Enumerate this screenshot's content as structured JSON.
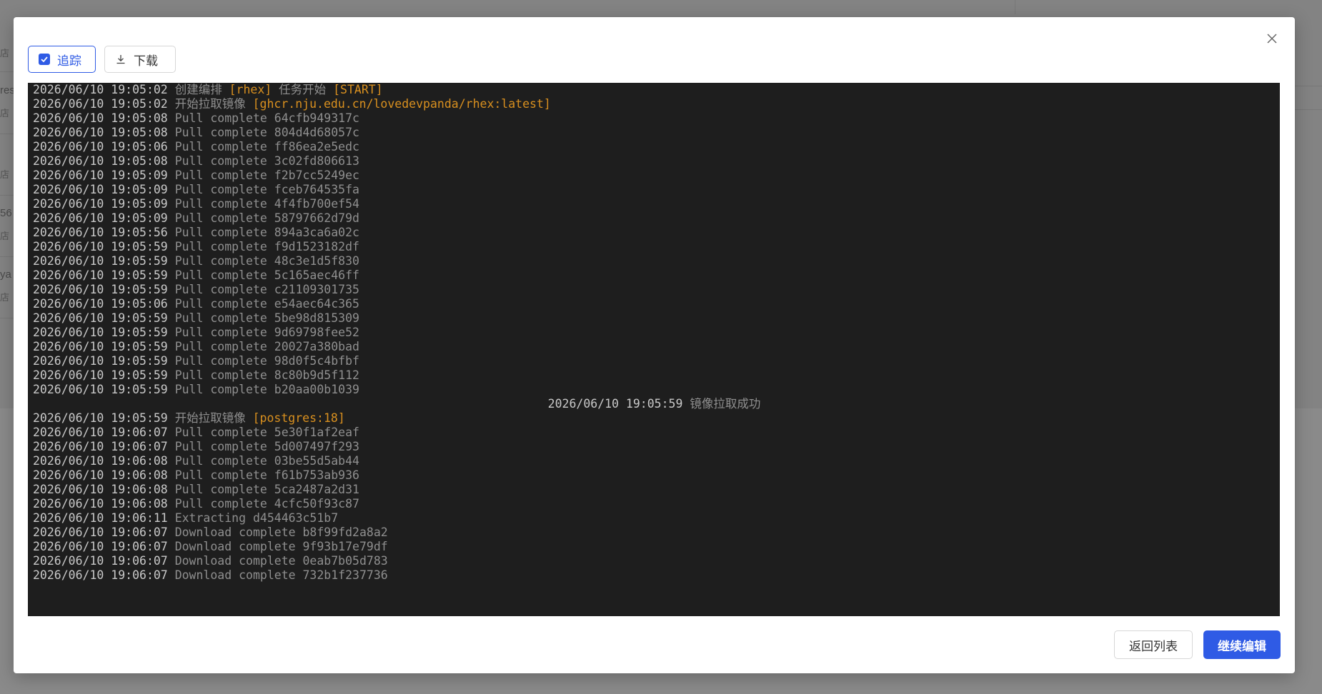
{
  "background": {
    "fragments": [
      "店",
      "res",
      "店",
      "店",
      "56",
      "店",
      "ya",
      "店"
    ]
  },
  "modal": {
    "toolbar": {
      "track_label": "追踪",
      "track_checked": true,
      "download_label": "下载"
    },
    "log": [
      {
        "ts": "2026/06/10 19:05:02",
        "msg": "创建编排 ",
        "hl": "[rhex]",
        "msg2": " 任务开始 ",
        "hl2": "[START]"
      },
      {
        "ts": "2026/06/10 19:05:02",
        "msg": "开始拉取镜像 ",
        "hl": "[ghcr.nju.edu.cn/lovedevpanda/rhex:latest]"
      },
      {
        "ts": "2026/06/10 19:05:08",
        "msg": "Pull complete 64cfb949317c"
      },
      {
        "ts": "2026/06/10 19:05:08",
        "msg": "Pull complete 804d4d68057c"
      },
      {
        "ts": "2026/06/10 19:05:06",
        "msg": "Pull complete ff86ea2e5edc"
      },
      {
        "ts": "2026/06/10 19:05:08",
        "msg": "Pull complete 3c02fd806613"
      },
      {
        "ts": "2026/06/10 19:05:09",
        "msg": "Pull complete f2b7cc5249ec"
      },
      {
        "ts": "2026/06/10 19:05:09",
        "msg": "Pull complete fceb764535fa"
      },
      {
        "ts": "2026/06/10 19:05:09",
        "msg": "Pull complete 4f4fb700ef54"
      },
      {
        "ts": "2026/06/10 19:05:09",
        "msg": "Pull complete 58797662d79d"
      },
      {
        "ts": "2026/06/10 19:05:56",
        "msg": "Pull complete 894a3ca6a02c"
      },
      {
        "ts": "2026/06/10 19:05:59",
        "msg": "Pull complete f9d1523182df"
      },
      {
        "ts": "2026/06/10 19:05:59",
        "msg": "Pull complete 48c3e1d5f830"
      },
      {
        "ts": "2026/06/10 19:05:59",
        "msg": "Pull complete 5c165aec46ff"
      },
      {
        "ts": "2026/06/10 19:05:59",
        "msg": "Pull complete c21109301735"
      },
      {
        "ts": "2026/06/10 19:05:06",
        "msg": "Pull complete e54aec64c365"
      },
      {
        "ts": "2026/06/10 19:05:59",
        "msg": "Pull complete 5be98d815309"
      },
      {
        "ts": "2026/06/10 19:05:59",
        "msg": "Pull complete 9d69798fee52"
      },
      {
        "ts": "2026/06/10 19:05:59",
        "msg": "Pull complete 20027a380bad"
      },
      {
        "ts": "2026/06/10 19:05:59",
        "msg": "Pull complete 98d0f5c4bfbf"
      },
      {
        "ts": "2026/06/10 19:05:59",
        "msg": "Pull complete 8c80b9d5f112"
      },
      {
        "ts": "2026/06/10 19:05:59",
        "msg": "Pull complete b20aa00b1039"
      },
      {
        "ts": "2026/06/10 19:05:59",
        "msg": "镜像拉取成功",
        "center": true
      },
      {
        "ts": "2026/06/10 19:05:59",
        "msg": "开始拉取镜像 ",
        "hl": "[postgres:18]"
      },
      {
        "ts": "2026/06/10 19:06:07",
        "msg": "Pull complete 5e30f1af2eaf"
      },
      {
        "ts": "2026/06/10 19:06:07",
        "msg": "Pull complete 5d007497f293"
      },
      {
        "ts": "2026/06/10 19:06:08",
        "msg": "Pull complete 03be55d5ab44"
      },
      {
        "ts": "2026/06/10 19:06:08",
        "msg": "Pull complete f61b753ab936"
      },
      {
        "ts": "2026/06/10 19:06:08",
        "msg": "Pull complete 5ca2487a2d31"
      },
      {
        "ts": "2026/06/10 19:06:08",
        "msg": "Pull complete 4cfc50f93c87"
      },
      {
        "ts": "2026/06/10 19:06:11",
        "msg": "Extracting d454463c51b7"
      },
      {
        "ts": "2026/06/10 19:06:07",
        "msg": "Download complete b8f99fd2a8a2"
      },
      {
        "ts": "2026/06/10 19:06:07",
        "msg": "Download complete 9f93b17e79df"
      },
      {
        "ts": "2026/06/10 19:06:07",
        "msg": "Download complete 0eab7b05d783"
      },
      {
        "ts": "2026/06/10 19:06:07",
        "msg": "Download complete 732b1f237736"
      }
    ],
    "footer": {
      "back_label": "返回列表",
      "continue_label": "继续编辑"
    }
  },
  "colors": {
    "primary": "#2f5be5",
    "terminal_bg": "#1e1e1e",
    "highlight": "#d9901f"
  }
}
